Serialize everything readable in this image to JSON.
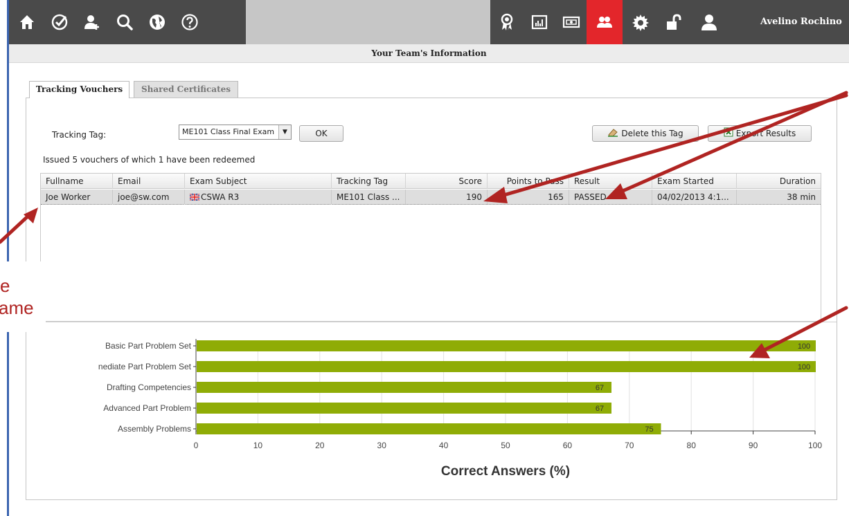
{
  "nav": {
    "left_icons": [
      "home-icon",
      "check-circle-icon",
      "add-user-icon",
      "search-icon",
      "globe-icon",
      "help-icon"
    ],
    "right_icons": [
      "award-ribbon-icon",
      "report-chart-icon",
      "voucher-icon",
      "team-icon",
      "settings-gear-icon",
      "unlock-icon"
    ],
    "active_icon": "team-icon",
    "user_name": "Avelino Rochino"
  },
  "page": {
    "title": "Your Team's Information"
  },
  "tabs": [
    {
      "label": "Tracking Vouchers",
      "active": true
    },
    {
      "label": "Shared Certificates",
      "active": false
    }
  ],
  "filter": {
    "label": "Tracking Tag:",
    "selected": "ME101 Class Final Exam",
    "ok_label": "OK",
    "delete_label": "Delete this Tag",
    "export_label": "Export Results"
  },
  "summary": "Issued 5 vouchers of which 1 have been redeemed",
  "table": {
    "columns": [
      "Fullname",
      "Email",
      "Exam Subject",
      "Tracking Tag",
      "Score",
      "Points to Pass",
      "Result",
      "Exam Started",
      "Duration"
    ],
    "rows": [
      {
        "fullname": "Joe Worker",
        "email": "joe@sw.com",
        "subject": "CSWA R3",
        "tag": "ME101 Class ...",
        "score": "190",
        "points_to_pass": "165",
        "result": "PASSED",
        "started": "04/02/2013 4:1...",
        "duration": "38 min"
      }
    ]
  },
  "chart_data": {
    "type": "bar",
    "orientation": "horizontal",
    "categories": [
      "Basic Part Problem Set",
      "Intermediate Part Problem Set",
      "Drafting Competencies",
      "Advanced Part Problem",
      "Assembly Problems"
    ],
    "category_labels": [
      "Basic Part Problem Set",
      "nediate Part Problem Set",
      "Drafting Competencies",
      "Advanced Part Problem",
      "Assembly Problems"
    ],
    "values": [
      100,
      100,
      67,
      67,
      75
    ],
    "xlabel": "Correct Answers (%)",
    "xlim": [
      0,
      100
    ],
    "ticks": [
      0,
      10,
      20,
      30,
      40,
      50,
      60,
      70,
      80,
      90,
      100
    ],
    "bar_color": "#8fac06",
    "grid": true
  },
  "annotation": {
    "lines": [
      "e",
      "ame"
    ],
    "color": "#b02422"
  },
  "colors": {
    "nav_dark": "#4a4a4a",
    "nav_active": "#e3262b",
    "arrow": "#b02422",
    "left_border": "#3b64b0"
  }
}
